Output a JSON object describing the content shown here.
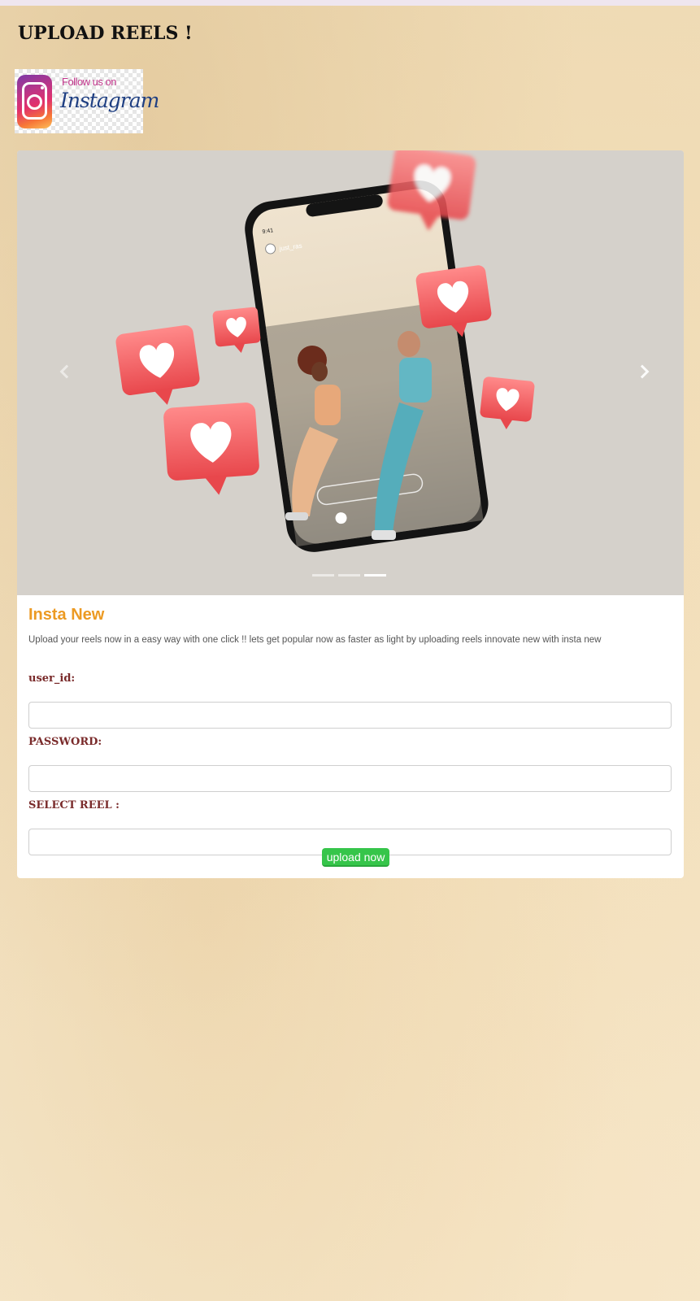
{
  "page": {
    "title": "UPLOAD REELS !"
  },
  "badge": {
    "follow_text": "Follow us on",
    "brand_text": "Instagram"
  },
  "carousel": {
    "slides": 3,
    "active_slide": 3,
    "phone_username": "just_ras",
    "phone_time": "9:41"
  },
  "card": {
    "title": "Insta New",
    "description": "Upload your reels now in a easy way with one click !! lets get popular now as faster as light by uploading reels innovate new with insta new"
  },
  "form": {
    "user_id_label": "user_id:",
    "user_id_value": "",
    "password_label": "PASSWORD:",
    "password_value": "",
    "reel_label": "SELECT REEL :",
    "reel_value": "",
    "submit_label": "upload now"
  },
  "colors": {
    "title_accent": "#ec9a23",
    "label": "#7a2b2b",
    "button": "#36c54a",
    "heart": "#ef5a5f"
  }
}
